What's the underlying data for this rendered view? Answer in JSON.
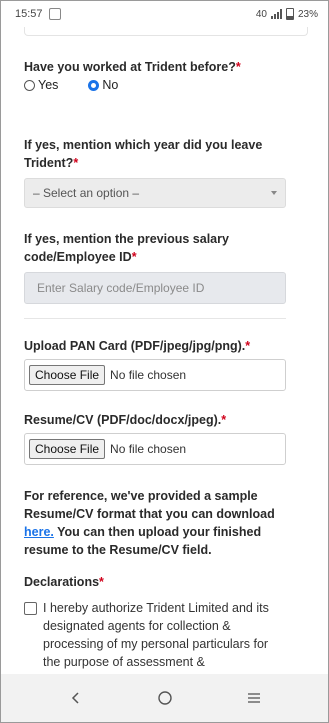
{
  "status_bar": {
    "time": "15:57",
    "network": "40",
    "battery": "23%"
  },
  "form": {
    "q1": {
      "label": "Have you worked at Trident before?",
      "required": "*",
      "options": [
        {
          "label": "Yes",
          "selected": false
        },
        {
          "label": "No",
          "selected": true
        }
      ]
    },
    "q2": {
      "label": "If yes, mention which year did you leave Trident?",
      "required": "*",
      "select_value": "– Select an option –"
    },
    "q3": {
      "label": "If yes, mention the previous salary code/Employee ID",
      "required": "*",
      "placeholder": "Enter Salary code/Employee ID"
    },
    "pan": {
      "label": "Upload PAN Card (PDF/jpeg/jpg/png).",
      "required": "*",
      "button": "Choose File",
      "status": "No file chosen"
    },
    "resume": {
      "label": "Resume/CV (PDF/doc/docx/jpeg).",
      "required": "*",
      "button": "Choose File",
      "status": "No file chosen"
    },
    "reference": {
      "text_before": "For reference, we've provided a sample Resume/CV format that you can download ",
      "link": "here.",
      "text_after": " You can then upload your finished resume to the Resume/CV field."
    },
    "declarations": {
      "label": "Declarations",
      "required": "*",
      "text": "I hereby authorize Trident Limited and its designated agents for collection & processing of my personal particulars for the purpose of assessment &"
    }
  },
  "nav": {
    "back": "back-icon",
    "home": "home-icon",
    "recents": "menu-icon"
  },
  "colors": {
    "accent": "#1a73e8",
    "required": "#d0021b"
  }
}
